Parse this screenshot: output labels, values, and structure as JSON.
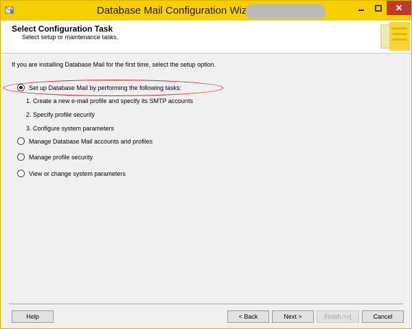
{
  "window": {
    "title": "Database Mail Configuration Wizard -",
    "close_glyph": "✕"
  },
  "header": {
    "title": "Select Configuration Task",
    "subtitle": "Select setup or maintenance tasks."
  },
  "intro": "If you are installing Database Mail for the first time, select the setup option.",
  "options": [
    {
      "label": "Set up Database Mail by performing the following tasks:",
      "selected": true
    },
    {
      "label": "Manage Database Mail accounts and profiles",
      "selected": false
    },
    {
      "label": "Manage profile security",
      "selected": false
    },
    {
      "label": "View or change system parameters",
      "selected": false
    }
  ],
  "setup_steps": [
    "1. Create a new e-mail profile and specify its SMTP accounts",
    "2. Specify profile security",
    "3. Configure system parameters"
  ],
  "buttons": {
    "help": "Help",
    "back": "< Back",
    "next": "Next >",
    "finish": "Finish >>|",
    "cancel": "Cancel"
  },
  "colors": {
    "titlebar": "#f7cf00",
    "close_button": "#c0392b",
    "highlight_ellipse": "#d92020"
  }
}
